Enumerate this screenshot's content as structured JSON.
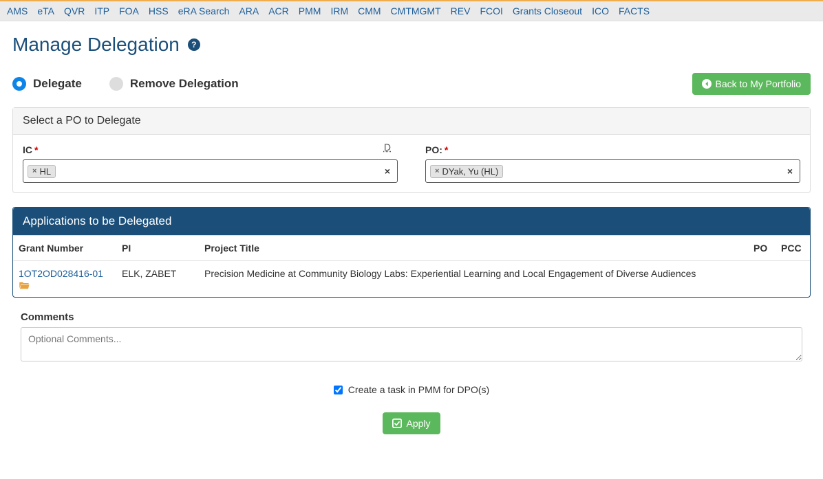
{
  "nav": [
    "AMS",
    "eTA",
    "QVR",
    "ITP",
    "FOA",
    "HSS",
    "eRA Search",
    "ARA",
    "ACR",
    "PMM",
    "IRM",
    "CMM",
    "CMTMGMT",
    "REV",
    "FCOI",
    "Grants Closeout",
    "ICO",
    "FACTS"
  ],
  "title": "Manage Delegation",
  "mode": {
    "delegate": "Delegate",
    "remove": "Remove Delegation"
  },
  "back_btn": "Back to My Portfolio",
  "po_panel": {
    "header": "Select a PO to Delegate",
    "ic_label": "IC",
    "ic_value": "HL",
    "hint": "D",
    "po_label": "PO:",
    "po_value": "DYak, Yu (HL)"
  },
  "apps_panel": {
    "header": "Applications to be Delegated",
    "cols": {
      "grant": "Grant Number",
      "pi": "PI",
      "title": "Project Title",
      "po": "PO",
      "pcc": "PCC"
    },
    "rows": [
      {
        "grant": "1OT2OD028416-01",
        "pi": "ELK, ZABET",
        "title": "Precision Medicine at Community Biology Labs: Experiential Learning and Local Engagement of Diverse Audiences",
        "po": "",
        "pcc": ""
      }
    ]
  },
  "comments": {
    "label": "Comments",
    "placeholder": "Optional Comments..."
  },
  "task_cb": "Create a task in PMM for DPO(s)",
  "apply_btn": "Apply"
}
